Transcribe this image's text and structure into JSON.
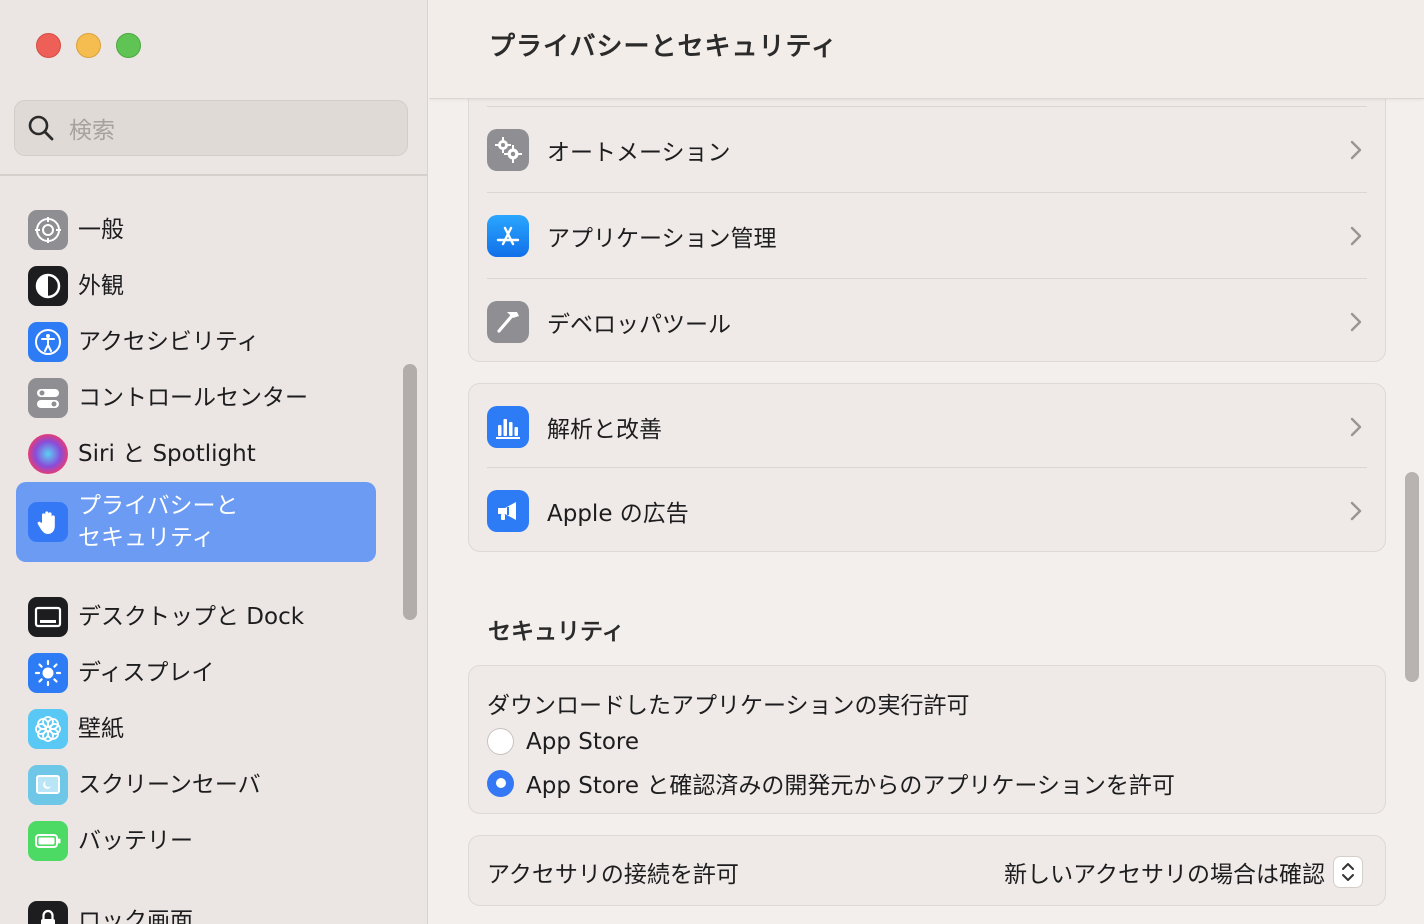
{
  "window": {
    "title": "プライバシーとセキュリティ"
  },
  "search": {
    "placeholder": "検索"
  },
  "sidebar": {
    "items": [
      {
        "label": "一般",
        "icon": "gear-icon"
      },
      {
        "label": "外観",
        "icon": "appearance-icon"
      },
      {
        "label": "アクセシビリティ",
        "icon": "accessibility-icon"
      },
      {
        "label": "コントロールセンター",
        "icon": "control-center-icon"
      },
      {
        "label": "Siri と Spotlight",
        "icon": "siri-icon"
      },
      {
        "label": "プライバシーと\nセキュリティ",
        "icon": "hand-icon",
        "active": true
      },
      {
        "label": "デスクトップと Dock",
        "icon": "desktop-dock-icon"
      },
      {
        "label": "ディスプレイ",
        "icon": "display-brightness-icon"
      },
      {
        "label": "壁紙",
        "icon": "wallpaper-flower-icon"
      },
      {
        "label": "スクリーンセーバ",
        "icon": "screensaver-icon"
      },
      {
        "label": "バッテリー",
        "icon": "battery-icon"
      },
      {
        "label": "ロック画面",
        "icon": "lock-icon"
      }
    ]
  },
  "privacy": {
    "rows_group1": [
      {
        "label": "オートメーション",
        "icon": "gears-icon"
      },
      {
        "label": "アプリケーション管理",
        "icon": "app-store-icon"
      },
      {
        "label": "デベロッパツール",
        "icon": "hammer-icon"
      }
    ],
    "rows_group2": [
      {
        "label": "解析と改善",
        "icon": "bar-chart-icon"
      },
      {
        "label": "Apple の広告",
        "icon": "megaphone-icon"
      }
    ]
  },
  "security": {
    "section_title": "セキュリティ",
    "download_title": "ダウンロードしたアプリケーションの実行許可",
    "options": [
      {
        "label": "App Store",
        "selected": false
      },
      {
        "label": "App Store と確認済みの開発元からのアプリケーションを許可",
        "selected": true
      }
    ],
    "accessory_label": "アクセサリの接続を許可",
    "accessory_value": "新しいアクセサリの場合は確認"
  },
  "colors": {
    "accent": "#3478f6",
    "sidebar_active": "#6b9bf2"
  }
}
